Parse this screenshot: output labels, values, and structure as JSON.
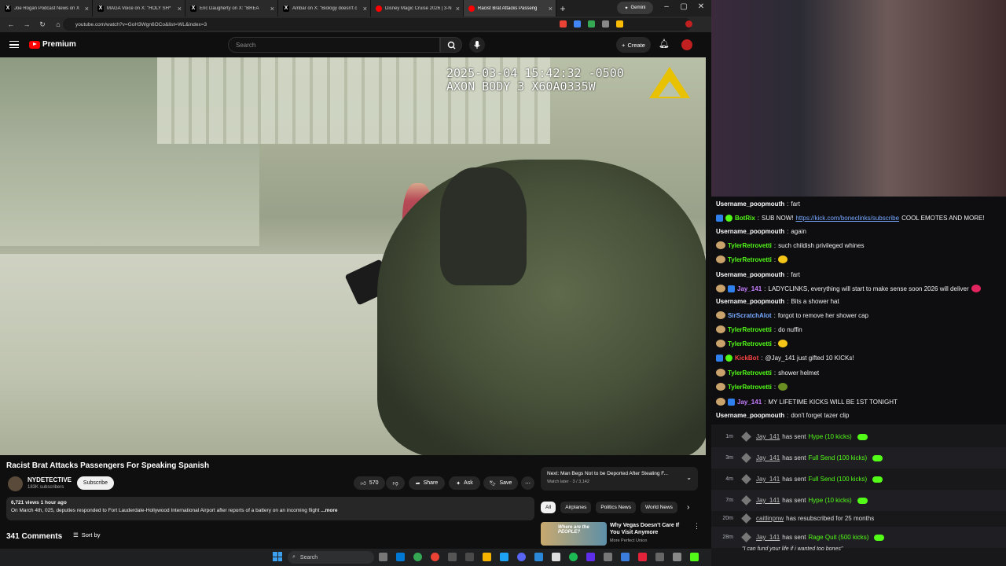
{
  "browser": {
    "tabs": [
      {
        "icon": "x-logo-icon",
        "title": "Joe Rogan Podcast News on X"
      },
      {
        "icon": "x-logo-icon",
        "title": "MAGA Voice on X: \"HOLY SH*"
      },
      {
        "icon": "x-logo-icon",
        "title": "Eric Daugherty on X: \"BREA"
      },
      {
        "icon": "x-logo-icon",
        "title": "Ambar on X: \"Biology doesn't c"
      },
      {
        "icon": "youtube-icon",
        "title": "Disney Magic Cruise 2026 | 3-N"
      },
      {
        "icon": "youtube-icon",
        "title": "Racist Brat Attacks Passeng"
      }
    ],
    "gemini_label": "Gemini",
    "url": "youtube.com/watch?v=GoH3Wgn6OCo&list=WL&index=3"
  },
  "youtube": {
    "logo_label": "Premium",
    "search_placeholder": "Search",
    "create_label": "Create",
    "video": {
      "timestamp_line1": "2025-03-04 15:42:32 -0500",
      "timestamp_line2": "AXON BODY 3 X60A0335W",
      "title": "Racist Brat Attacks Passengers For Speaking Spanish",
      "channel": "NYDETECTIVE",
      "subscribers": "183K subscribers",
      "subscribe_label": "Subscribe",
      "likes": "570",
      "share_label": "Share",
      "ask_label": "Ask",
      "save_label": "Save",
      "views_age": "6,721 views  1 hour ago",
      "description": "On March 4th, 025, deputies responded to Fort Lauderdale-Hollywood International Airport after reports of a battery on an incoming flight",
      "more_label": "...more",
      "comments_count": "341 Comments",
      "sort_label": "Sort by"
    },
    "next_up": {
      "title": "Next: Man Begs Not to be Deported After Stealing F...",
      "sub": "Watch later · 3 / 3,142"
    },
    "chips": [
      "All",
      "Airplanes",
      "Politics News",
      "World News"
    ],
    "recommendation": {
      "thumb_text": "Where are the PEOPLE?",
      "title": "Why Vegas Doesn't Care If You Visit Anymore",
      "channel": "More Perfect Union"
    }
  },
  "taskbar": {
    "search_label": "Search"
  },
  "chat": {
    "messages": [
      {
        "user": "Username_poopmouth",
        "color": "#ffffff",
        "text": "fart"
      },
      {
        "user": "BotRix",
        "color": "#53fc18",
        "text": "SUB NOW!",
        "link": "https://kick.com/boneclinks/subscribe",
        "after": "COOL EMOTES AND MORE!"
      },
      {
        "user": "Username_poopmouth",
        "color": "#ffffff",
        "text": "again"
      },
      {
        "user": "TylerRetrovetti",
        "color": "#53fc18",
        "text": "such childish privileged whines"
      },
      {
        "user": "TylerRetrovetti",
        "color": "#53fc18",
        "text": ""
      },
      {
        "user": "Username_poopmouth",
        "color": "#ffffff",
        "text": "fart"
      },
      {
        "user": "Jay_141",
        "color": "#c77dff",
        "text": "LADYCLINKS, everything will start to make sense soon 2026 will deliver"
      },
      {
        "user": "Username_poopmouth",
        "color": "#ffffff",
        "text": "Bits a shower hat"
      },
      {
        "user": "SirScratchAlot",
        "color": "#76a8ff",
        "text": "forgot to remove her shower cap"
      },
      {
        "user": "TylerRetrovetti",
        "color": "#53fc18",
        "text": "do nuffin"
      },
      {
        "user": "TylerRetrovetti",
        "color": "#53fc18",
        "text": ""
      },
      {
        "user": "KickBot",
        "color": "#ff4444",
        "text": "@Jay_141 just gifted 10 KICKs!"
      },
      {
        "user": "TylerRetrovetti",
        "color": "#53fc18",
        "text": "shower helmet"
      },
      {
        "user": "TylerRetrovetti",
        "color": "#53fc18",
        "text": ""
      },
      {
        "user": "Jay_141",
        "color": "#c77dff",
        "text": "MY LIFETIME KICKS WILL BE 1ST TONIGHT"
      },
      {
        "user": "Username_poopmouth",
        "color": "#ffffff",
        "text": "don't forget tazer clip"
      }
    ]
  },
  "events": [
    {
      "time": "1m",
      "user": "Jay_141",
      "mid": "has sent",
      "item": "Hype (10 kicks)"
    },
    {
      "time": "3m",
      "user": "Jay_141",
      "mid": "has sent",
      "item": "Full Send (100 kicks)"
    },
    {
      "time": "4m",
      "user": "Jay_141",
      "mid": "has sent",
      "item": "Full Send (100 kicks)"
    },
    {
      "time": "7m",
      "user": "Jay_141",
      "mid": "has sent",
      "item": "Hype (10 kicks)"
    },
    {
      "time": "20m",
      "user": "caitlinpnw",
      "mid": "has resubscribed for 25 months",
      "item": ""
    },
    {
      "time": "28m",
      "user": "Jay_141",
      "mid": "has sent",
      "item": "Rage Quit (500 kicks)"
    }
  ],
  "event_note": "\"I can fund your life if i wanted too bones\""
}
